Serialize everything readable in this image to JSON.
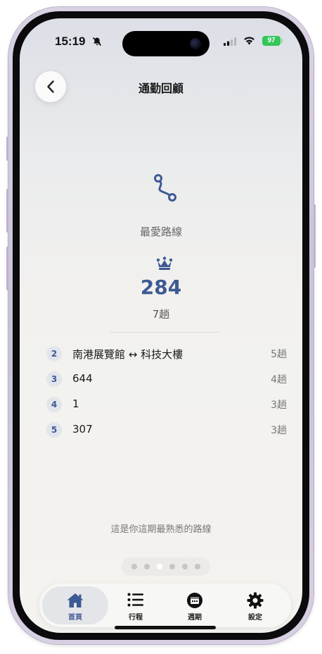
{
  "status_bar": {
    "time": "15:19",
    "battery": "97"
  },
  "header": {
    "title": "通勤回顧"
  },
  "favorite": {
    "label": "最愛路線",
    "top_route": "284",
    "top_trips": "7趟"
  },
  "ranking": [
    {
      "rank": "2",
      "name": "南港展覽館 ↔ 科技大樓",
      "trips": "5趟"
    },
    {
      "rank": "3",
      "name": "644",
      "trips": "4趟"
    },
    {
      "rank": "4",
      "name": "1",
      "trips": "3趟"
    },
    {
      "rank": "5",
      "name": "307",
      "trips": "3趟"
    }
  ],
  "caption": "這是你這期最熟悉的路線",
  "pager": {
    "total_pages": 6,
    "active_page": 3
  },
  "tabs": [
    {
      "label": "首頁",
      "icon": "home-icon",
      "active": true
    },
    {
      "label": "行程",
      "icon": "list-icon",
      "active": false
    },
    {
      "label": "週期",
      "icon": "calendar-icon",
      "active": false
    },
    {
      "label": "設定",
      "icon": "gear-icon",
      "active": false
    }
  ],
  "colors": {
    "accent": "#3e5a94"
  }
}
